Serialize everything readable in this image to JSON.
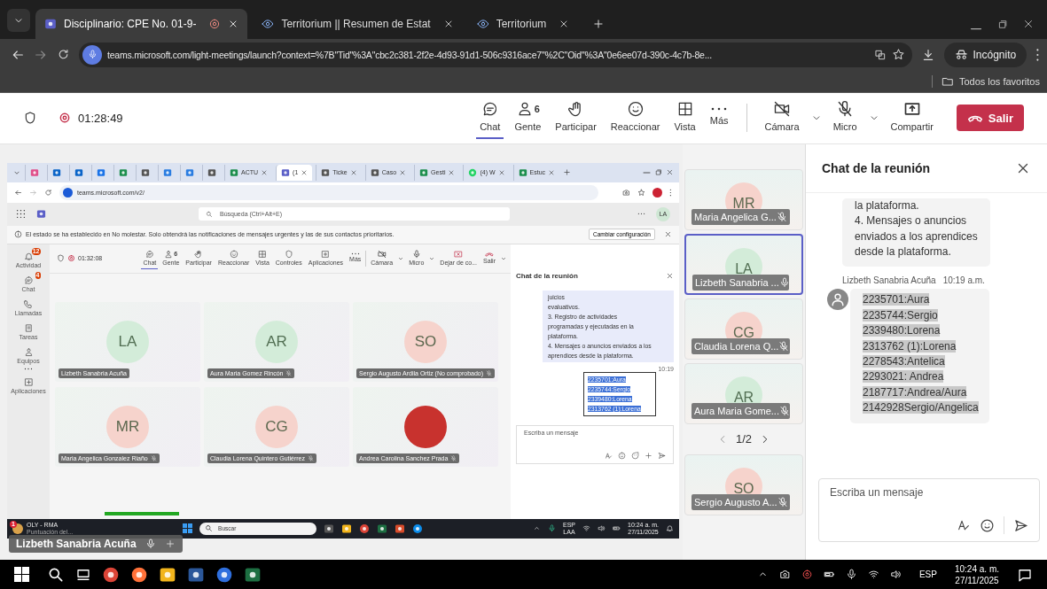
{
  "browser": {
    "tabs": [
      {
        "title": "Disciplinario: CPE No. 01-9-",
        "kind": "teams",
        "recording": true,
        "selected": true
      },
      {
        "title": "Territorium || Resumen de Estat",
        "kind": "eye",
        "recording": false,
        "selected": false
      },
      {
        "title": "Territorium",
        "kind": "eye",
        "recording": false,
        "selected": false
      }
    ],
    "url": "teams.microsoft.com/light-meetings/launch?context=%7B\"Tid\"%3A\"cbc2c381-2f2e-4d93-91d1-506c9316ace7\"%2C\"Oid\"%3A\"0e6ee07d-390c-4c7b-8e...",
    "profile": "Incógnito",
    "bookmarks": "Todos los favoritos"
  },
  "meeting_toolbar": {
    "timer": "01:28:49",
    "actions": [
      {
        "label": "Chat",
        "kind": "chat",
        "selected": true
      },
      {
        "label": "Gente",
        "kind": "people",
        "count": "6",
        "selected": false
      },
      {
        "label": "Participar",
        "kind": "hand",
        "selected": false
      },
      {
        "label": "Reaccionar",
        "kind": "smiley",
        "selected": false
      },
      {
        "label": "Vista",
        "kind": "grid",
        "selected": false
      },
      {
        "label": "Más",
        "kind": "more",
        "selected": false
      }
    ],
    "controls": [
      {
        "label": "Cámara",
        "kind": "camoff"
      },
      {
        "label": "Micro",
        "kind": "micoff"
      },
      {
        "label": "Compartir",
        "kind": "share"
      }
    ],
    "leave": "Salir"
  },
  "shared_screen": {
    "tabs": [
      {
        "kind": "copilot",
        "selected": false
      },
      {
        "kind": "outlook",
        "selected": false
      },
      {
        "kind": "outlook",
        "selected": false
      },
      {
        "kind": "calendar",
        "selected": false
      },
      {
        "kind": "sheet",
        "selected": false
      },
      {
        "kind": "g",
        "selected": false
      },
      {
        "kind": "cloud",
        "selected": false
      },
      {
        "kind": "cloud",
        "selected": false
      },
      {
        "kind": "g",
        "selected": false
      },
      {
        "kind": "sheet",
        "label": "ACTU",
        "selected": false
      },
      {
        "kind": "teams",
        "label": "(1",
        "selected": true
      },
      {
        "kind": "g",
        "label": "Ticke",
        "selected": false
      },
      {
        "kind": "g",
        "label": "Caso",
        "selected": false
      },
      {
        "kind": "sheet",
        "label": "Gesti",
        "selected": false
      },
      {
        "kind": "whatsapp",
        "label": "(4) W",
        "selected": false
      },
      {
        "kind": "sheet",
        "label": "Estuc",
        "selected": false
      }
    ],
    "url": "teams.microsoft.com/v2/",
    "search_placeholder": "Búsqueda (Ctrl+Alt+E)",
    "avatar": "LA",
    "notice": "El estado se ha establecido en No molestar. Solo obtendrá las notificaciones de mensajes urgentes y las de sus contactos prioritarios.",
    "notice_button": "Cambiar configuración",
    "rail": [
      {
        "label": "Actividad",
        "kind": "bell",
        "badge": "12"
      },
      {
        "label": "Chat",
        "kind": "chat",
        "badge": "4"
      },
      {
        "label": "Llamadas",
        "kind": "phone"
      },
      {
        "label": "Tareas",
        "kind": "tasks"
      },
      {
        "label": "Equipos",
        "kind": "people"
      },
      {
        "label": "Aplicaciones",
        "kind": "plusbox"
      }
    ],
    "timer": "01:32:08",
    "actions": [
      {
        "label": "Chat",
        "kind": "chat",
        "selected": true
      },
      {
        "label": "Gente",
        "kind": "people",
        "count": "6",
        "selected": false
      },
      {
        "label": "Participar",
        "kind": "hand",
        "selected": false
      },
      {
        "label": "Reaccionar",
        "kind": "smiley",
        "selected": false
      },
      {
        "label": "Vista",
        "kind": "grid",
        "selected": false
      },
      {
        "label": "Controles",
        "kind": "shield",
        "selected": false
      },
      {
        "label": "Aplicaciones",
        "kind": "plusbox",
        "selected": false
      },
      {
        "label": "Más",
        "kind": "more",
        "selected": false
      }
    ],
    "controls": [
      {
        "label": "Cámara",
        "kind": "camoff"
      },
      {
        "label": "Micro",
        "kind": "mic"
      },
      {
        "label": "Dejar de co...",
        "kind": "stopshare"
      },
      {
        "label": "Salir",
        "kind": "leave"
      }
    ],
    "tiles": [
      {
        "kind": "initials",
        "initials": "LA",
        "name": "Lizbeth Sanabria Acuña",
        "color": "#d3ecd9",
        "muted": false
      },
      {
        "kind": "initials",
        "initials": "AR",
        "name": "Aura Maria Gomez Rincón",
        "color": "#d3ecd9",
        "muted": true
      },
      {
        "kind": "initials",
        "initials": "SO",
        "name": "Sergio Augusto Ardila Ortiz (No comprobado)",
        "color": "#f6d3cc",
        "muted": true
      },
      {
        "kind": "initials",
        "initials": "MR",
        "name": "Maria Angelica Gonzalez Riaño",
        "color": "#f6d3cc",
        "muted": true
      },
      {
        "kind": "initials",
        "initials": "CG",
        "name": "Claudia Lorena Quintero Gutiérrez",
        "color": "#f6d3cc",
        "muted": true
      },
      {
        "kind": "photo",
        "name": "Andrea Carolina Sanchez Prada",
        "muted": true
      }
    ],
    "chat": {
      "title": "Chat de la reunión",
      "message": [
        "juicios",
        "evaluativos.",
        "3. Registro de actividades",
        "programadas y ejecutadas en la",
        "plataforma.",
        "4. Mensajes o anuncios enviados a los",
        "aprendices desde la plataforma."
      ],
      "time": "10:19",
      "selected_lines": [
        "2235701:Aura",
        "2235744:Sergio",
        "2339480:Lorena",
        "2313762 (1):Lorena"
      ],
      "placeholder": "Escriba un mensaje"
    },
    "taskbar": {
      "app": "OLY - RMA",
      "app_subtitle": "Puntuación del...",
      "badge": "1",
      "search": "Buscar",
      "lang": "ESP",
      "layout": "LAA",
      "time": "10:24 a. m.",
      "date": "27/11/2025"
    }
  },
  "presenter_label": "Lizbeth Sanabria Acuña",
  "participants": {
    "tiles": [
      {
        "initials": "MR",
        "name": "Maria Angelica G...",
        "color": "#f6d3cc",
        "muted": true,
        "selected": false
      },
      {
        "initials": "LA",
        "name": "Lizbeth Sanabria ...",
        "color": "#d3ecd9",
        "muted": false,
        "selected": true
      },
      {
        "initials": "CG",
        "name": "Claudia Lorena Q...",
        "color": "#f6d3cc",
        "muted": true,
        "selected": false
      },
      {
        "initials": "AR",
        "name": "Aura Maria Gome...",
        "color": "#d3ecd9",
        "muted": true,
        "selected": false
      }
    ],
    "pager": "1/2",
    "more_tiles": [
      {
        "initials": "SO",
        "name": "Sergio Augusto A...",
        "color": "#f6d3cc",
        "muted": true,
        "selected": false
      }
    ]
  },
  "chat": {
    "title": "Chat de la reunión",
    "messages": [
      {
        "lines": [
          "la plataforma.",
          "4. Mensajes o anuncios",
          "enviados a los aprendices",
          "desde la plataforma."
        ],
        "highlighted": false
      },
      {
        "sender": "Lizbeth Sanabria Acuña",
        "time": "10:19 a.m.",
        "lines": [
          "2235701:Aura",
          "2235744:Sergio",
          "2339480:Lorena",
          "2313762 (1):Lorena",
          "2278543:Antelica",
          "2293021: Andrea",
          "2187717:Andrea/Aura",
          "2142928Sergio/Angelica"
        ],
        "highlighted": true
      }
    ],
    "placeholder": "Escriba un mensaje"
  },
  "taskbar": {
    "apps": [
      {
        "kind": "chrome"
      },
      {
        "kind": "firefox"
      },
      {
        "kind": "folder"
      },
      {
        "kind": "word"
      },
      {
        "kind": "bluecircle"
      },
      {
        "kind": "excel"
      }
    ],
    "lang": "ESP",
    "time": "10:24 a. m.",
    "date": "27/11/2025"
  }
}
